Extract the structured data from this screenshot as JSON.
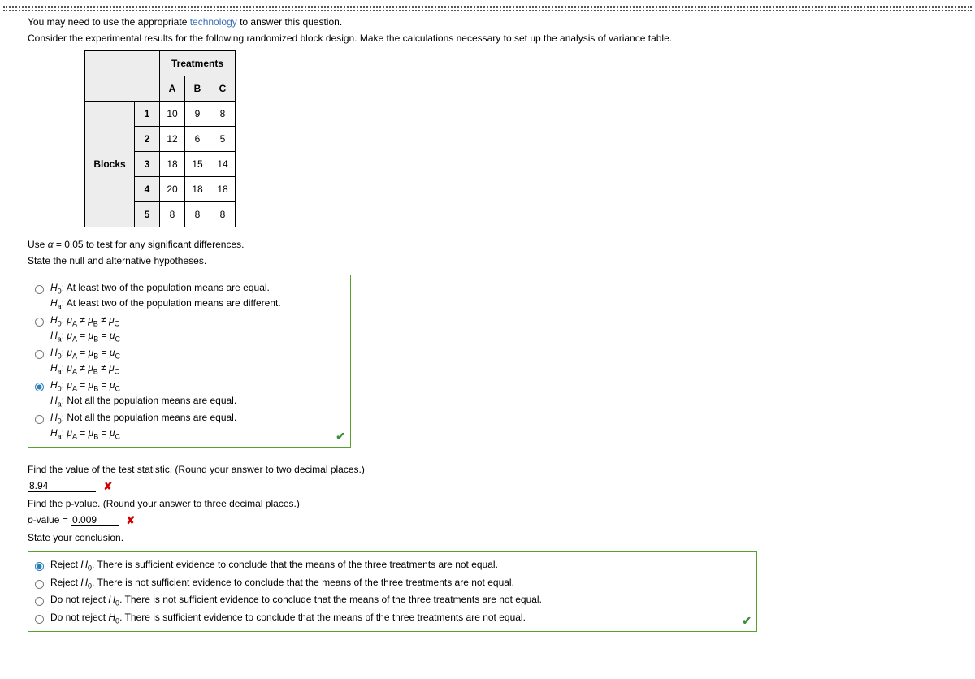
{
  "intro_prefix": "You may need to use the appropriate ",
  "tech_link": "technology",
  "intro_suffix": " to answer this question.",
  "instruction": "Consider the experimental results for the following randomized block design. Make the calculations necessary to set up the analysis of variance table.",
  "table": {
    "treatments_label": "Treatments",
    "blocks_label": "Blocks",
    "treatment_headers": [
      "A",
      "B",
      "C"
    ],
    "block_nums": [
      "1",
      "2",
      "3",
      "4",
      "5"
    ],
    "rows": [
      [
        "10",
        "9",
        "8"
      ],
      [
        "12",
        "6",
        "5"
      ],
      [
        "18",
        "15",
        "14"
      ],
      [
        "20",
        "18",
        "18"
      ],
      [
        "8",
        "8",
        "8"
      ]
    ]
  },
  "alpha_line_prefix": "Use ",
  "alpha_sym": "α",
  "alpha_eq": " = 0.05 to test for any significant differences.",
  "state_hyp": "State the null and alternative hypotheses.",
  "hyp_options": [
    {
      "h0": "At least two of the population means are equal.",
      "ha": "At least two of the population means are different.",
      "type": "text"
    },
    {
      "h0": "μA ≠ μB ≠ μC",
      "ha": "μA = μB = μC",
      "type": "formula"
    },
    {
      "h0": "μA = μB = μC",
      "ha": "μA ≠ μB ≠ μC",
      "type": "formula"
    },
    {
      "h0": "μA = μB = μC",
      "ha": "Not all the population means are equal.",
      "type": "mixed",
      "selected": true
    },
    {
      "h0": "Not all the population means are equal.",
      "ha": "μA = μB = μC",
      "type": "mixed2"
    }
  ],
  "find_test_stat": "Find the value of the test statistic. (Round your answer to two decimal places.)",
  "test_stat_value": "8.94",
  "find_pvalue": "Find the p-value. (Round your answer to three decimal places.)",
  "pvalue_label_prefix": "p",
  "pvalue_label_suffix": "-value = ",
  "pvalue_value": "0.009",
  "state_conclusion": "State your conclusion.",
  "conclusion_options": [
    {
      "prefix": "Reject ",
      "h": "H0",
      "text": ". There is sufficient evidence to conclude that the means of the three treatments are not equal.",
      "selected": true
    },
    {
      "prefix": "Reject ",
      "h": "H0",
      "text": ". There is not sufficient evidence to conclude that the means of the three treatments are not equal."
    },
    {
      "prefix": "Do not reject ",
      "h": "H0",
      "text": ". There is not sufficient evidence to conclude that the means of the three treatments are not equal."
    },
    {
      "prefix": "Do not reject ",
      "h": "H0",
      "text": ". There is sufficient evidence to conclude that the means of the three treatments are not equal."
    }
  ],
  "icons": {
    "check": "✔",
    "wrong": "✘"
  }
}
